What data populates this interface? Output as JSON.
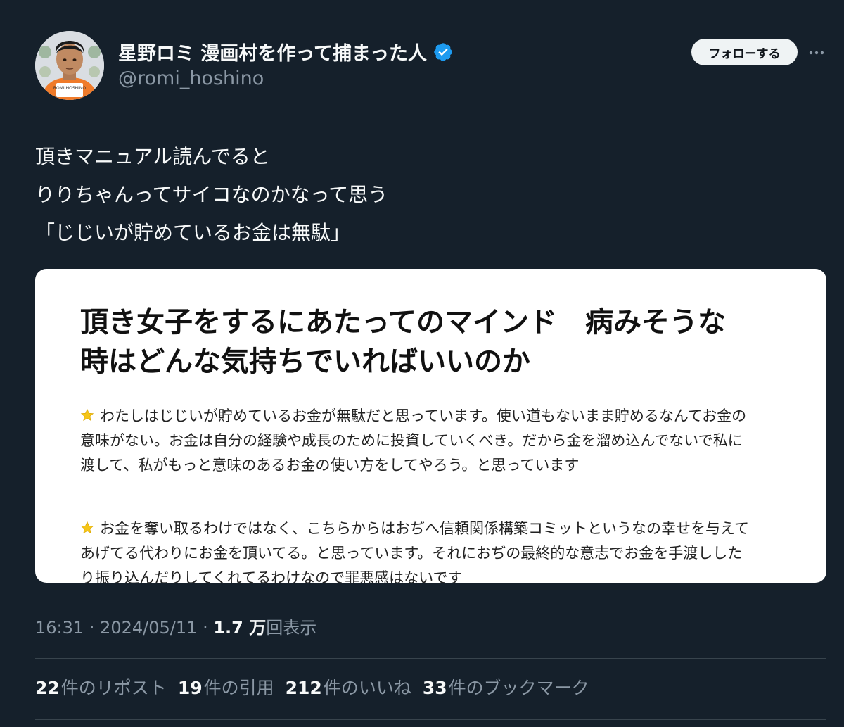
{
  "author": {
    "display_name": "星野ロミ 漫画村を作って捕まった人",
    "handle": "@romi_hoshino",
    "verified": true,
    "avatar_icon": "person-photo-avatar",
    "avatar_text": "ROMI HOSHINO"
  },
  "follow_label": "フォローする",
  "more_icon": "more-horizontal-icon",
  "tweet": {
    "lines": [
      "頂きマニュアル読んでると",
      "りりちゃんってサイコなのかなって思う",
      "「じじいが貯めているお金は無駄」"
    ]
  },
  "media": {
    "title_lines": [
      "頂き女子をするにあたってのマインド　病みそうな",
      "時はどんな気持ちでいればいいのか"
    ],
    "paragraphs": [
      {
        "lines": [
          "わたしはじじいが貯めているお金が無駄だと思っています。使い道もないまま貯めるなんてお金の",
          "意味がない。お金は自分の経験や成長のために投資していくべき。だから金を溜め込んでないで私に",
          "渡して、私がもっと意味のあるお金の使い方をしてやろう。と思っています"
        ]
      },
      {
        "lines": [
          "お金を奪い取るわけではなく、こちらからはおぢへ信頼関係構築コミットというなの幸せを与えて",
          "あげてる代わりにお金を頂いてる。と思っています。それにおぢの最終的な意志でお金を手渡しした",
          "り振り込んだりしてくれてるわけなので罪悪感はないです"
        ]
      }
    ],
    "bullet_icon": "star-icon"
  },
  "meta": {
    "time": "16:31",
    "separator": "·",
    "date": "2024/05/11",
    "views_count": "1.7 万",
    "views_label": "回表示"
  },
  "stats": {
    "reposts": {
      "num": "22",
      "label": "件のリポスト"
    },
    "quotes": {
      "num": "19",
      "label": "件の引用"
    },
    "likes": {
      "num": "212",
      "label": "件のいいね"
    },
    "bookmarks": {
      "num": "33",
      "label": "件のブックマーク"
    }
  },
  "colors": {
    "background": "#15202b",
    "verified": "#1d9bf0",
    "secondary_text": "#8b98a5"
  }
}
